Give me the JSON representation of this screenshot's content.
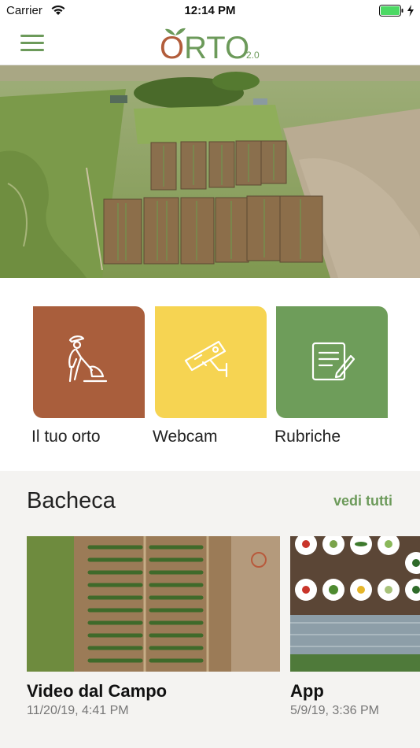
{
  "status_bar": {
    "carrier": "Carrier",
    "time": "12:14 PM",
    "wifi_icon": "wifi-icon",
    "battery_icon": "battery-full-icon",
    "charging_icon": "charging-bolt-icon"
  },
  "navbar": {
    "menu_icon": "hamburger-menu-icon",
    "logo_first": "O",
    "logo_rest": "RTO",
    "logo_version": "2.0"
  },
  "hero": {
    "image": "aerial-garden-photo"
  },
  "tiles": [
    {
      "label": "Il tuo orto",
      "icon": "gardener-shoveling-icon",
      "color": "#a95e3c"
    },
    {
      "label": "Webcam",
      "icon": "security-camera-icon",
      "color": "#f6d452"
    },
    {
      "label": "Rubriche",
      "icon": "notepad-pencil-icon",
      "color": "#6e9d5a"
    }
  ],
  "bacheca": {
    "title": "Bacheca",
    "see_all": "vedi tutti",
    "cards": [
      {
        "title": "Video dal Campo",
        "date": "11/20/19, 4:41 PM",
        "image": "aerial-field-rows-photo"
      },
      {
        "title": "App",
        "date": "5/9/19, 3:36 PM",
        "image": "vegetable-grid-photo"
      }
    ]
  },
  "colors": {
    "accent_green": "#6c9a5a",
    "brand_brown": "#b25d3b",
    "section_bg": "#f4f3f1"
  }
}
